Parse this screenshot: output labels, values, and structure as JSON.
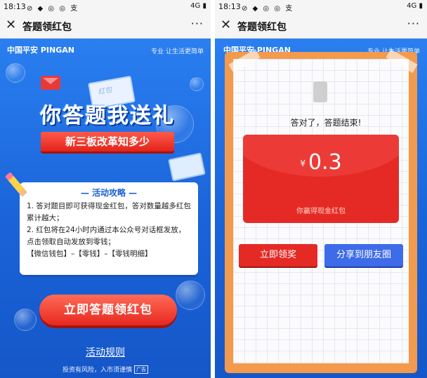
{
  "statusbar": {
    "time": "18:13",
    "apps": "⊘ ◆ ◎ ◎ 支",
    "network": "4G",
    "battery": "▮"
  },
  "window": {
    "title": "答题领红包",
    "close": "✕",
    "more": "···"
  },
  "brand": {
    "name": "中国平安 PINGAN",
    "slogan": "专业 让生活更简单"
  },
  "left": {
    "decor_text": "红包",
    "hero": "你答题我送礼",
    "subtitle": "新三板改革知多少",
    "guide_title": "— 活动攻略 —",
    "guide_items": [
      "1. 答对题目即可获得现金红包，答对数量越多红包累计越大；",
      "2. 红包将在24小时内通过本公众号对话框发放，点击领取自动发放到零钱；",
      "【微信钱包】–【零钱】–【零钱明细】"
    ],
    "cta": "立即答题领红包",
    "rules": "活动规则",
    "risk": "投资有风险，入市须谨慎",
    "ad": "广告"
  },
  "right": {
    "done": "答对了，答题结束!",
    "currency": "¥",
    "amount": "0.3",
    "won": "你赢得现金红包",
    "claim": "立即领奖",
    "share": "分享到朋友圈"
  },
  "colors": {
    "primary_blue": "#1f6fe3",
    "red": "#e52a26",
    "orange_frame": "#f39a4d",
    "share_blue": "#3e6be8"
  }
}
